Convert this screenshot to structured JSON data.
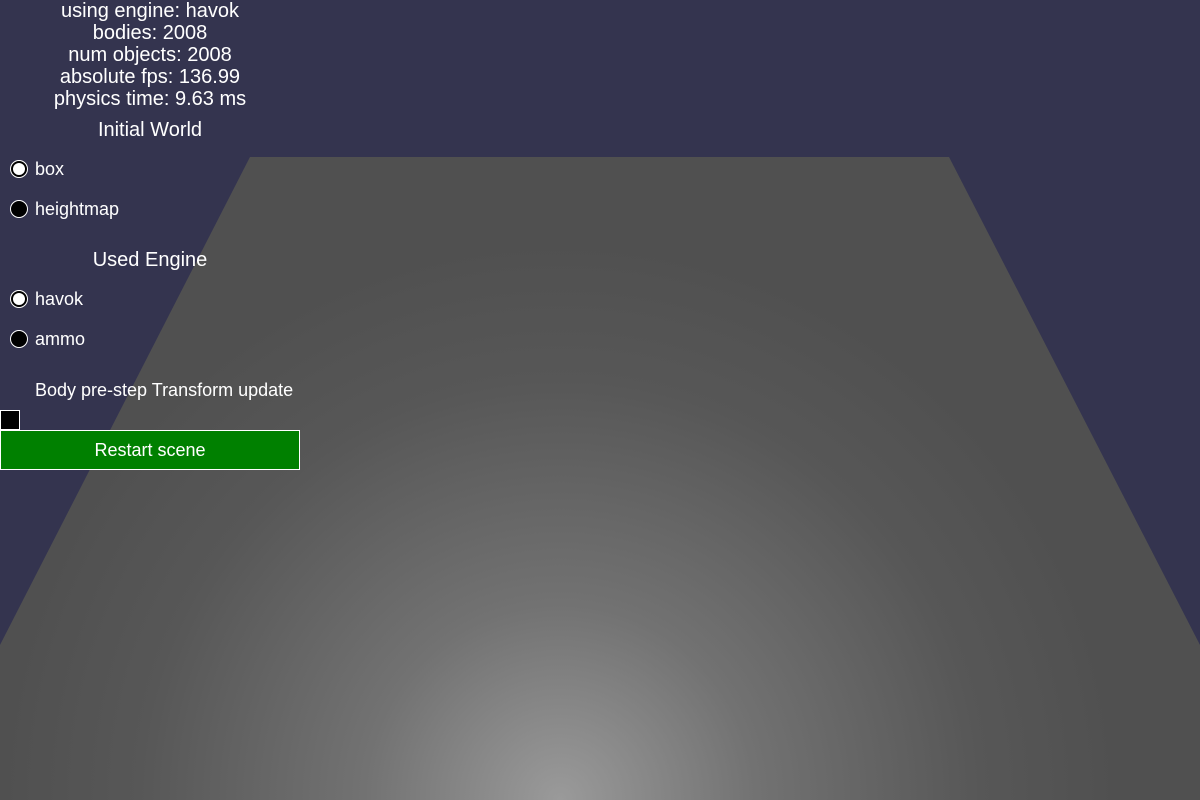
{
  "stats": {
    "engine_line": "using engine: havok",
    "bodies_line": "bodies: 2008",
    "objects_line": "num objects: 2008",
    "fps_line": "absolute fps: 136.99",
    "physics_time_line": "physics time: 9.63 ms"
  },
  "initial_world": {
    "header": "Initial World",
    "options": [
      {
        "label": "box",
        "checked": true
      },
      {
        "label": "heightmap",
        "checked": false
      }
    ]
  },
  "used_engine": {
    "header": "Used Engine",
    "options": [
      {
        "label": "havok",
        "checked": true
      },
      {
        "label": "ammo",
        "checked": false
      }
    ]
  },
  "transform_update": {
    "label": "Body pre-step Transform update",
    "checked": false
  },
  "restart_button": {
    "label": "Restart scene"
  },
  "colors": {
    "background": "#34344f",
    "ground": "#505050",
    "button_green": "#008000",
    "text": "#ffffff"
  }
}
